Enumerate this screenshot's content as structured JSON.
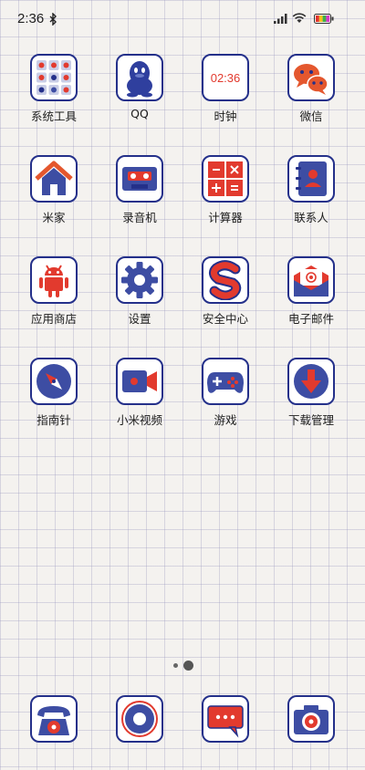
{
  "status_bar": {
    "time": "2:36",
    "icons": [
      "bluetooth-icon",
      "signal-icon",
      "wifi-icon",
      "battery-icon"
    ]
  },
  "apps": [
    {
      "label": "系统工具",
      "icon": "system-tools-folder-icon"
    },
    {
      "label": "QQ",
      "icon": "qq-penguin-icon"
    },
    {
      "label": "时钟",
      "icon": "clock-icon",
      "display": "02:36"
    },
    {
      "label": "微信",
      "icon": "wechat-icon"
    },
    {
      "label": "米家",
      "icon": "home-icon"
    },
    {
      "label": "录音机",
      "icon": "cassette-recorder-icon"
    },
    {
      "label": "计算器",
      "icon": "calculator-icon"
    },
    {
      "label": "联系人",
      "icon": "contacts-book-icon"
    },
    {
      "label": "应用商店",
      "icon": "android-robot-icon"
    },
    {
      "label": "设置",
      "icon": "gear-icon"
    },
    {
      "label": "安全中心",
      "icon": "security-s-icon"
    },
    {
      "label": "电子邮件",
      "icon": "email-envelope-icon"
    },
    {
      "label": "指南针",
      "icon": "compass-icon"
    },
    {
      "label": "小米视频",
      "icon": "video-camera-icon"
    },
    {
      "label": "游戏",
      "icon": "gamepad-icon"
    },
    {
      "label": "下载管理",
      "icon": "download-arrow-icon"
    }
  ],
  "dock": [
    {
      "icon": "telephone-icon"
    },
    {
      "icon": "browser-ring-icon"
    },
    {
      "icon": "message-bubble-icon"
    },
    {
      "icon": "camera-icon"
    }
  ],
  "page_indicator": {
    "pages": 2,
    "current": 2
  },
  "colors": {
    "navy": "#24308a",
    "blue_fill": "#3d4da3",
    "red": "#e23a2e",
    "grid": "#9a9ac0",
    "background": "#f4f2ef"
  }
}
